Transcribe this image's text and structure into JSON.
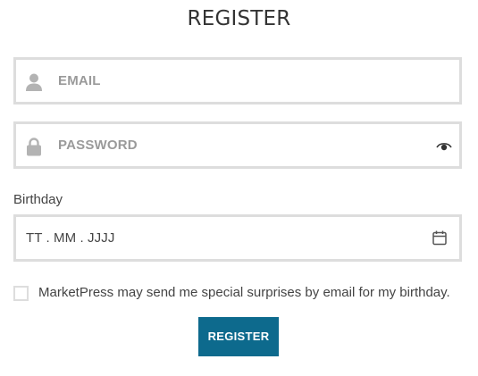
{
  "header": {
    "title": "REGISTER"
  },
  "email": {
    "placeholder": "EMAIL",
    "icon": "user-icon"
  },
  "password": {
    "placeholder": "PASSWORD",
    "icon": "lock-icon",
    "toggle_icon": "eye-icon"
  },
  "birthday": {
    "label": "Birthday",
    "value": "TT . MM . JJJJ",
    "icon": "calendar-icon"
  },
  "consent": {
    "label": "MarketPress may send me special surprises by email for my birthday.",
    "checked": false
  },
  "submit": {
    "label": "REGISTER"
  },
  "colors": {
    "accent": "#0d6a8d",
    "border": "#dddddd",
    "placeholder": "#9a9a9a",
    "icon": "#b3b3b3"
  }
}
